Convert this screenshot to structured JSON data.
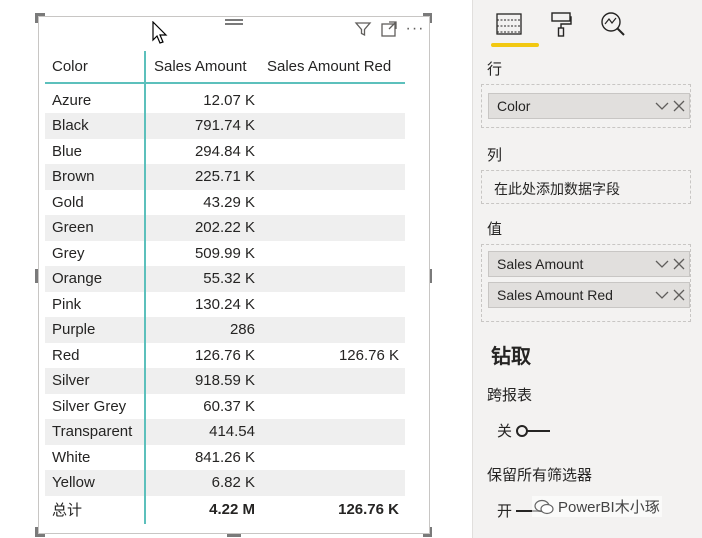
{
  "table": {
    "headers": [
      "Color",
      "Sales Amount",
      "Sales Amount Red"
    ],
    "rows": [
      {
        "color": "Azure",
        "sales": "12.07 K",
        "red": ""
      },
      {
        "color": "Black",
        "sales": "791.74 K",
        "red": ""
      },
      {
        "color": "Blue",
        "sales": "294.84 K",
        "red": ""
      },
      {
        "color": "Brown",
        "sales": "225.71 K",
        "red": ""
      },
      {
        "color": "Gold",
        "sales": "43.29 K",
        "red": ""
      },
      {
        "color": "Green",
        "sales": "202.22 K",
        "red": ""
      },
      {
        "color": "Grey",
        "sales": "509.99 K",
        "red": ""
      },
      {
        "color": "Orange",
        "sales": "55.32 K",
        "red": ""
      },
      {
        "color": "Pink",
        "sales": "130.24 K",
        "red": ""
      },
      {
        "color": "Purple",
        "sales": "286",
        "red": ""
      },
      {
        "color": "Red",
        "sales": "126.76 K",
        "red": "126.76 K"
      },
      {
        "color": "Silver",
        "sales": "918.59 K",
        "red": ""
      },
      {
        "color": "Silver Grey",
        "sales": "60.37 K",
        "red": ""
      },
      {
        "color": "Transparent",
        "sales": "414.54",
        "red": ""
      },
      {
        "color": "White",
        "sales": "841.26 K",
        "red": ""
      },
      {
        "color": "Yellow",
        "sales": "6.82 K",
        "red": ""
      }
    ],
    "total": {
      "label": "总计",
      "sales": "4.22 M",
      "red": "126.76 K"
    }
  },
  "toolbar": {
    "filter_icon": "filter-icon",
    "focus_icon": "focus-mode-icon",
    "more_icon": "more-options-icon",
    "more_label": "···"
  },
  "pane": {
    "tabs": [
      "fields-tab-icon",
      "format-tab-icon",
      "analytics-tab-icon"
    ],
    "rows_label": "行",
    "rows_field": "Color",
    "columns_label": "列",
    "columns_placeholder": "在此处添加数据字段",
    "values_label": "值",
    "values_fields": [
      "Sales Amount",
      "Sales Amount Red"
    ],
    "drill_title": "钻取",
    "cross_report_label": "跨报表",
    "cross_report_state": "关",
    "keep_filters_label": "保留所有筛选器",
    "keep_filters_state": "开"
  },
  "watermark": "PowerBI木小琢",
  "colors": {
    "accent_teal": "#5cc0bc",
    "tab_underline": "#f2c811",
    "pane_bg": "#f3f2f1"
  }
}
